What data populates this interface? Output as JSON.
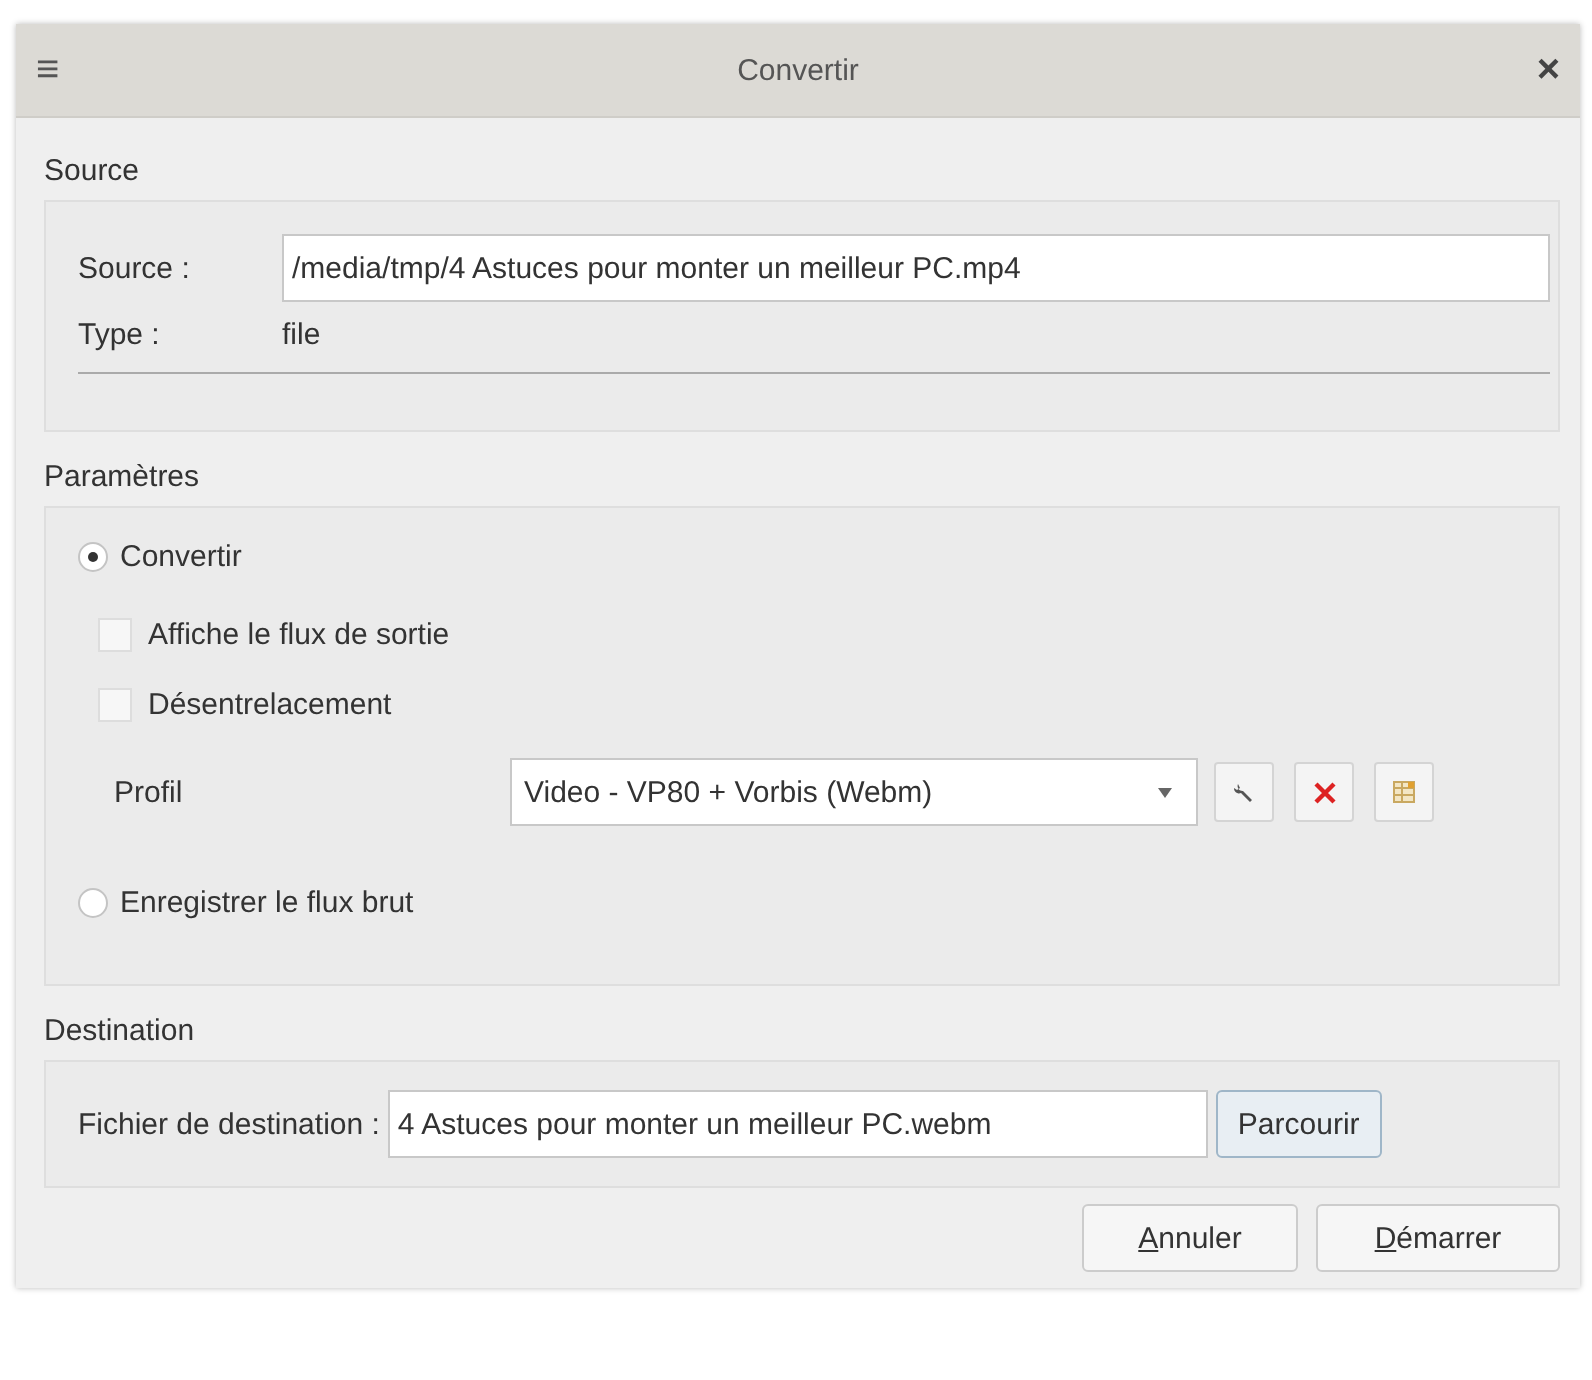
{
  "window": {
    "title": "Convertir",
    "menu_glyph": "≡",
    "close_glyph": "×"
  },
  "source": {
    "heading": "Source",
    "source_label": "Source :",
    "source_value": "/media/tmp/4 Astuces pour monter un meilleur PC.mp4",
    "type_label": "Type :",
    "type_value": "file"
  },
  "parameters": {
    "heading": "Paramètres",
    "modes": [
      {
        "label": "Convertir",
        "selected": true
      },
      {
        "label": "Enregistrer le flux brut",
        "selected": false
      }
    ],
    "options": [
      {
        "label": "Affiche le flux de sortie",
        "checked": false
      },
      {
        "label": "Désentrelacement",
        "checked": false
      }
    ],
    "profile_label": "Profil",
    "profile_value": "Video - VP80 + Vorbis (Webm)",
    "profile_tools": [
      {
        "kind": "edit"
      },
      {
        "kind": "delete"
      },
      {
        "kind": "new"
      }
    ]
  },
  "destination": {
    "heading": "Destination",
    "file_label": "Fichier de destination :",
    "file_value": "4 Astuces pour monter un meilleur PC.webm",
    "browse_button": "Parcourir"
  },
  "buttons": [
    "Annuler",
    "Démarrer"
  ]
}
